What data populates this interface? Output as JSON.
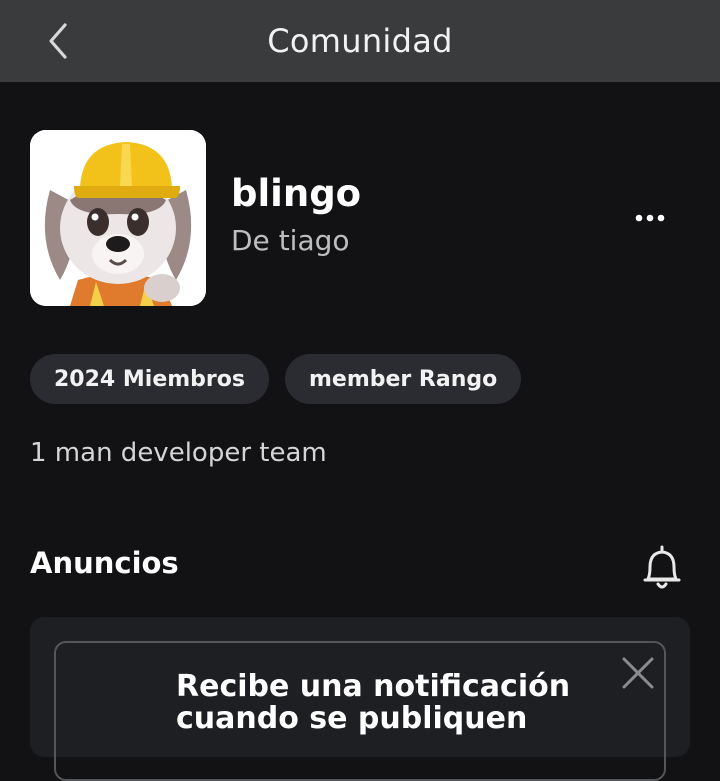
{
  "header": {
    "title": "Comunidad",
    "back_icon": "chevron-left-icon"
  },
  "group": {
    "name": "blingo",
    "owner": "De tiago",
    "avatar_icon": "dog-with-hardhat-avatar",
    "more_icon": "more-horizontal-icon",
    "chips": [
      {
        "label": "2024 Miembros"
      },
      {
        "label": "member Rango"
      }
    ],
    "description": "1 man developer team"
  },
  "announcements": {
    "title": "Anuncios",
    "bell_icon": "bell-icon",
    "notify_text": "Recibe una notificación cuando se publiquen",
    "close_icon": "close-icon"
  },
  "colors": {
    "background": "#121215",
    "header_bg": "#393b3d",
    "chip_bg": "#2b2c31",
    "panel_bg": "#1e1f23"
  }
}
